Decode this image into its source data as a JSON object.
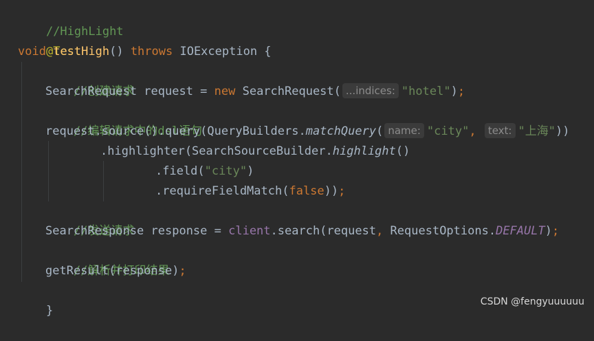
{
  "code": {
    "line1_comment": "//HighLight",
    "line2_annotation": "@Test",
    "line3": {
      "kw_void": "void",
      "method_name": "testHigh",
      "parens": "() ",
      "kw_throws": "throws",
      "exception": " IOException {"
    },
    "line4_comment": "//创建请求",
    "line5": {
      "type": "SearchRequest request = ",
      "kw_new": "new",
      "ctor": " SearchRequest(",
      "hint": "...indices:",
      "arg": "\"hotel\"",
      "close": ")",
      "semi": ";"
    },
    "line6_comment": "//编辑请求中的dsl语句",
    "line7": {
      "start": "request.source().query(QueryBuilders.",
      "method": "matchQuery",
      "open": "(",
      "hint1": "name:",
      "arg1": "\"city\"",
      "comma": ",",
      "hint2": "text:",
      "arg2": "\"上海\"",
      "close": "))"
    },
    "line8": {
      "start": ".highlighter(SearchSourceBuilder.",
      "method": "highlight",
      "close": "()"
    },
    "line9": {
      "start": ".field(",
      "arg": "\"city\"",
      "close": ")"
    },
    "line10": {
      "start": ".requireFieldMatch(",
      "arg": "false",
      "close": "))",
      "semi": ";"
    },
    "line11_comment": "//发送请求",
    "line12": {
      "start": "SearchResponse response = ",
      "field": "client",
      "call": ".search(request",
      "comma": ",",
      "mid": " RequestOptions.",
      "constant": "DEFAULT",
      "close": ")",
      "semi": ";"
    },
    "line13_comment": "//解析并打印结果",
    "line14": {
      "start": "getResult(response)",
      "semi": ";"
    },
    "line15": "}"
  },
  "watermark": "CSDN @fengyuuuuuu",
  "colors": {
    "background": "#2b2b2b",
    "default_text": "#a9b7c6",
    "comment": "#629755",
    "annotation": "#bbb529",
    "keyword": "#cc7832",
    "method_declaration": "#ffc66d",
    "string": "#6a8759",
    "field": "#9876aa"
  }
}
